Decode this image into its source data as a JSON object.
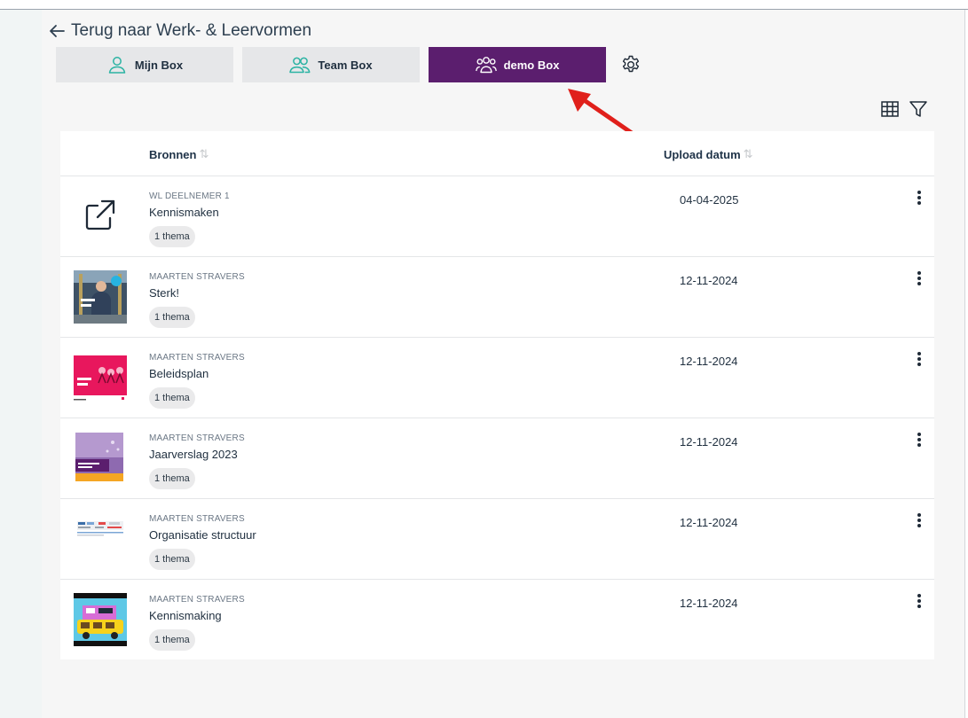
{
  "nav": {
    "back_label": "Terug naar Werk- & Leervormen"
  },
  "tabs": [
    {
      "label": "Mijn Box",
      "icon": "user-icon",
      "active": false
    },
    {
      "label": "Team Box",
      "icon": "users-icon",
      "active": false
    },
    {
      "label": "demo Box",
      "icon": "group-icon",
      "active": true
    }
  ],
  "table": {
    "columns": {
      "bronnen": "Bronnen",
      "upload_datum": "Upload datum"
    },
    "rows": [
      {
        "author": "WL DEELNEMER 1",
        "title": "Kennismaken",
        "badge": "1 thema",
        "date": "04-04-2025",
        "thumb": "external-link-icon"
      },
      {
        "author": "MAARTEN STRAVERS",
        "title": "Sterk!",
        "badge": "1 thema",
        "date": "12-11-2024",
        "thumb": "cover-photo"
      },
      {
        "author": "MAARTEN STRAVERS",
        "title": "Beleidsplan",
        "badge": "1 thema",
        "date": "12-11-2024",
        "thumb": "pink-cover"
      },
      {
        "author": "MAARTEN STRAVERS",
        "title": "Jaarverslag 2023",
        "badge": "1 thema",
        "date": "12-11-2024",
        "thumb": "purple-cover"
      },
      {
        "author": "MAARTEN STRAVERS",
        "title": "Organisatie structuur",
        "badge": "1 thema",
        "date": "12-11-2024",
        "thumb": "org-chart"
      },
      {
        "author": "MAARTEN STRAVERS",
        "title": "Kennismaking",
        "badge": "1 thema",
        "date": "12-11-2024",
        "thumb": "video-still"
      }
    ]
  },
  "colors": {
    "accent": "#5b1e6e",
    "teal": "#2bb3a3",
    "annotation_arrow": "#e0201b"
  }
}
